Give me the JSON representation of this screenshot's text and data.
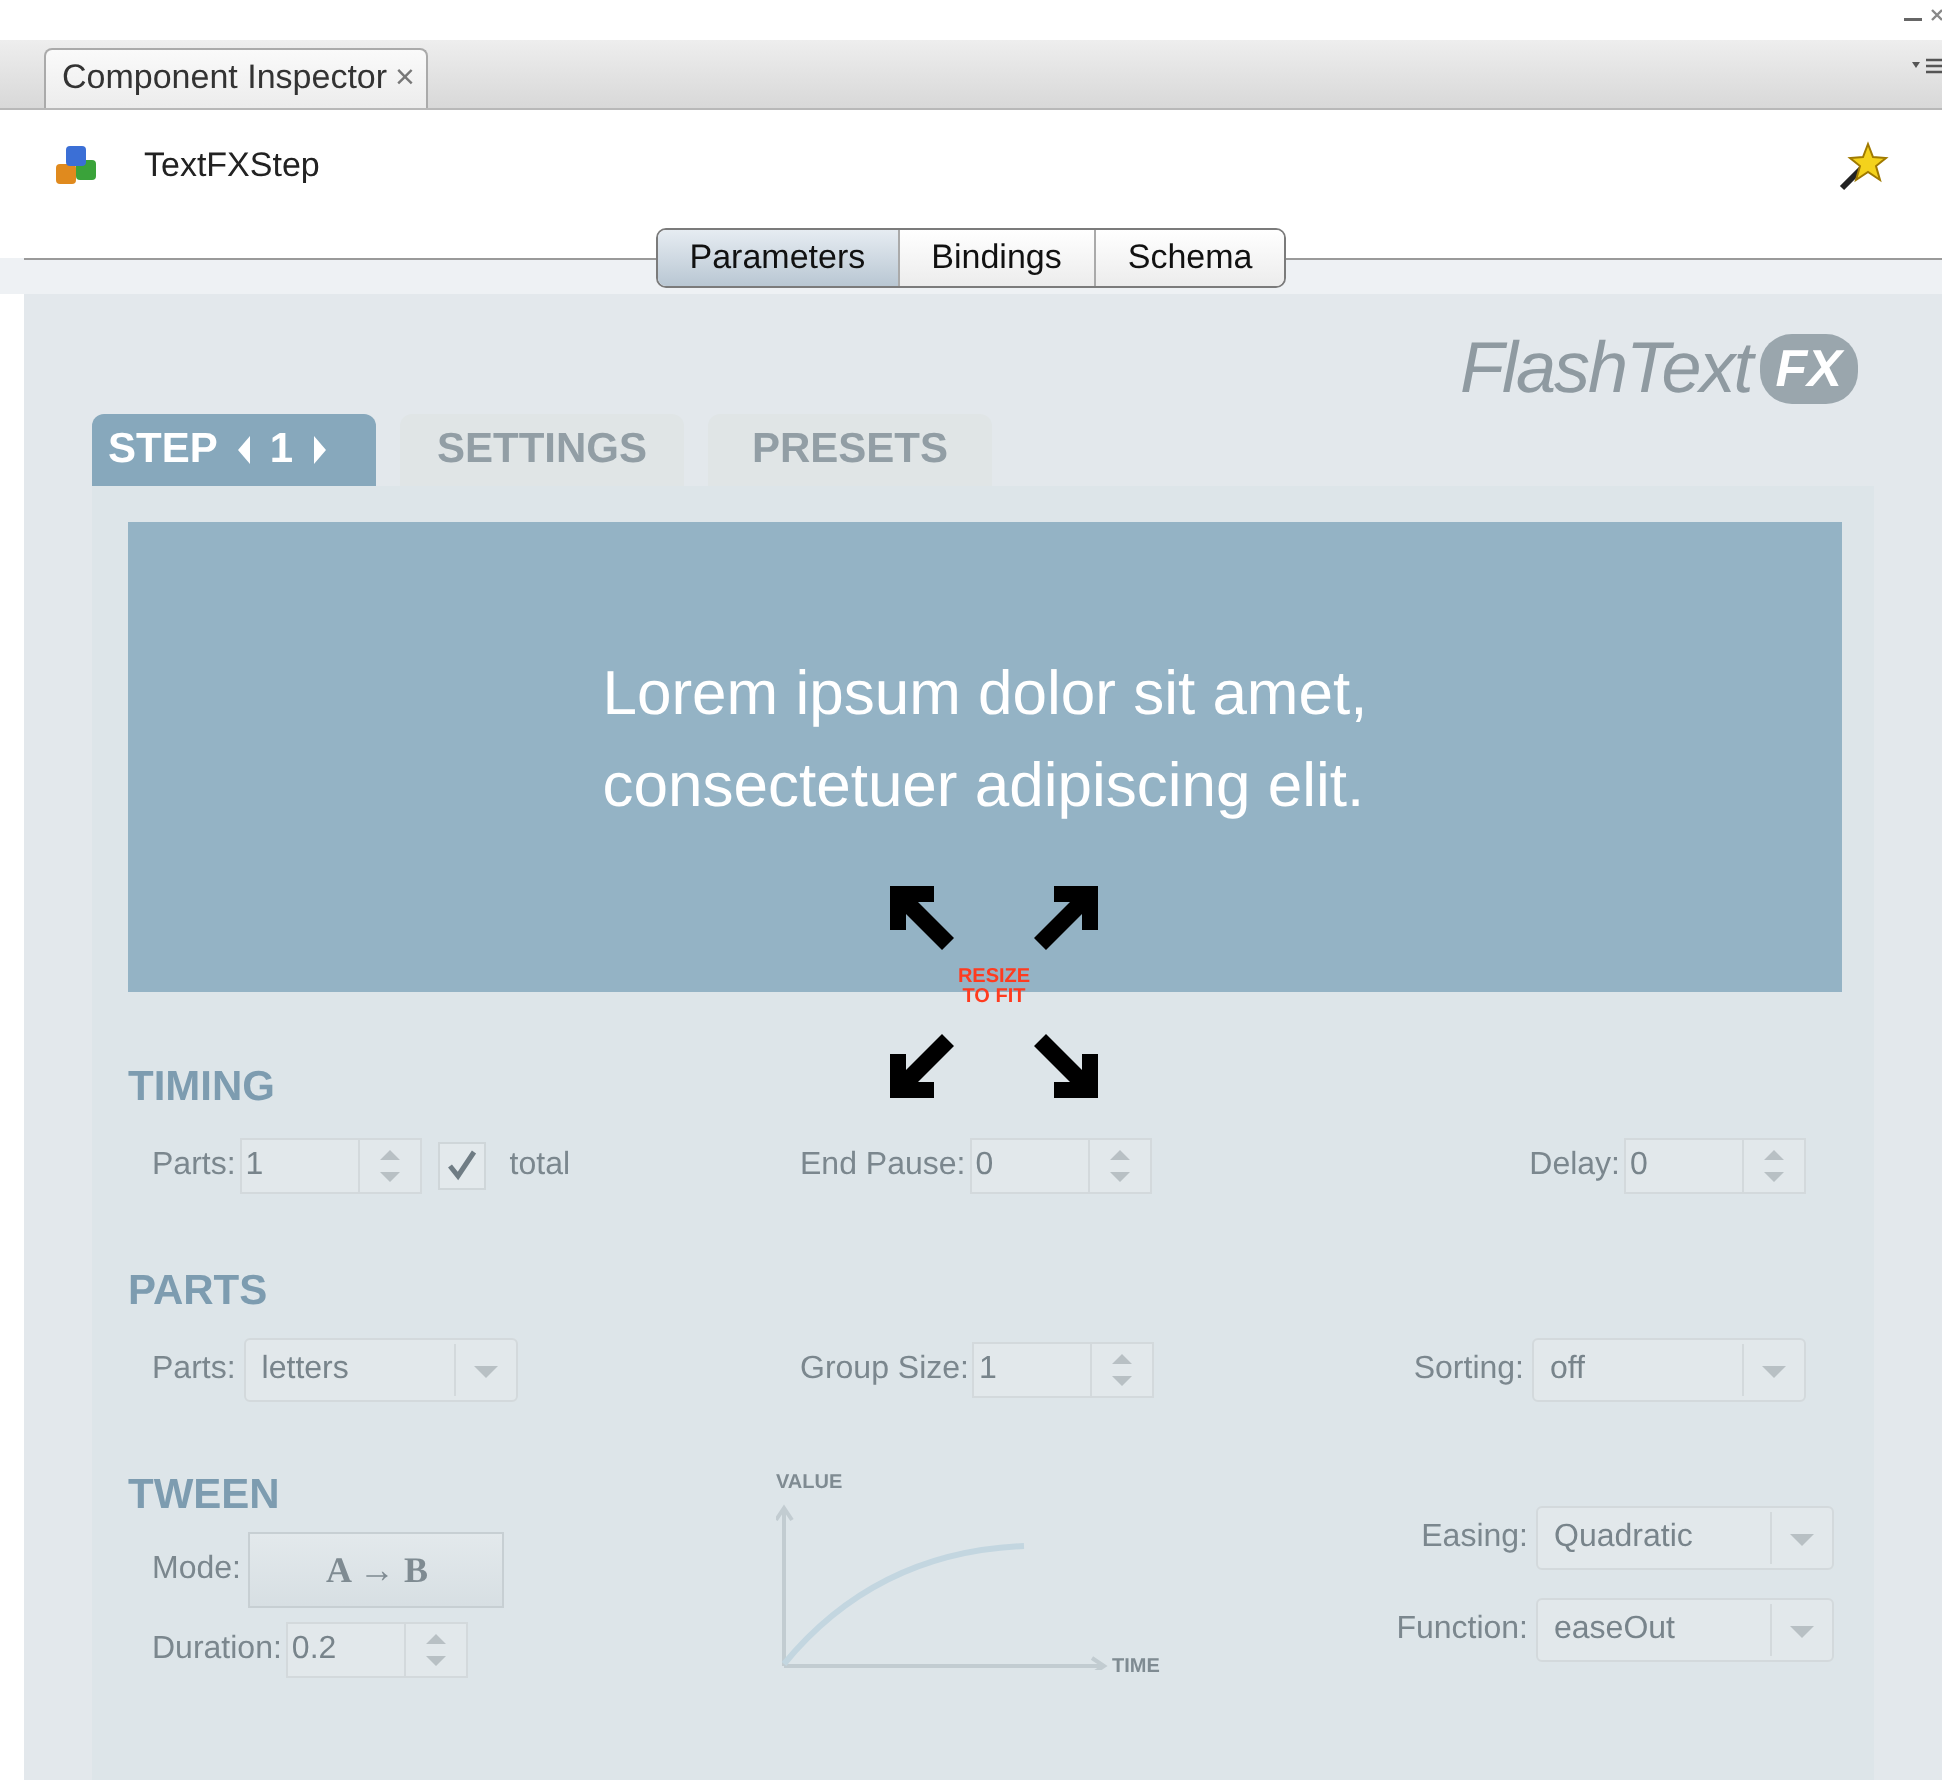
{
  "window": {
    "tab_title": "Component Inspector",
    "tab_close": "×"
  },
  "component": {
    "name": "TextFXStep"
  },
  "view_tabs": [
    {
      "label": "Parameters",
      "selected": true
    },
    {
      "label": "Bindings",
      "selected": false
    },
    {
      "label": "Schema",
      "selected": false
    }
  ],
  "logo": {
    "text": "FlashText",
    "badge": "FX"
  },
  "step_tabs": [
    {
      "kind": "stepper",
      "label": "STEP",
      "value": "1",
      "selected": true
    },
    {
      "kind": "plain",
      "label": "SETTINGS",
      "selected": false
    },
    {
      "kind": "plain",
      "label": "PRESETS",
      "selected": false
    }
  ],
  "preview": {
    "lines": [
      "Lorem ipsum dolor sit amet,",
      "consectetuer adipiscing elit."
    ]
  },
  "resize_overlay": {
    "lines": [
      "RESIZE",
      "TO FIT"
    ]
  },
  "sections": [
    {
      "title": "TIMING",
      "fields": [
        {
          "kind": "spinner",
          "label": "Parts:",
          "value": "1",
          "checkbox": {
            "label": "total",
            "checked": true
          }
        },
        {
          "kind": "spinner",
          "label": "End Pause:",
          "value": "0"
        },
        {
          "kind": "spinner",
          "label": "Delay:",
          "value": "0"
        }
      ]
    },
    {
      "title": "PARTS",
      "fields": [
        {
          "kind": "dropdown",
          "label": "Parts:",
          "value": "letters"
        },
        {
          "kind": "spinner",
          "label": "Group Size:",
          "value": "1"
        },
        {
          "kind": "dropdown",
          "label": "Sorting:",
          "value": "off"
        }
      ]
    }
  ],
  "tween": {
    "title": "TWEEN",
    "mode": {
      "label": "Mode:",
      "value": "A → B"
    },
    "duration": {
      "label": "Duration:",
      "value": "0.2"
    },
    "graph": {
      "ylabel": "VALUE",
      "xlabel": "TIME"
    },
    "easing": {
      "label": "Easing:",
      "value": "Quadratic"
    },
    "function": {
      "label": "Function:",
      "value": "easeOut"
    }
  }
}
